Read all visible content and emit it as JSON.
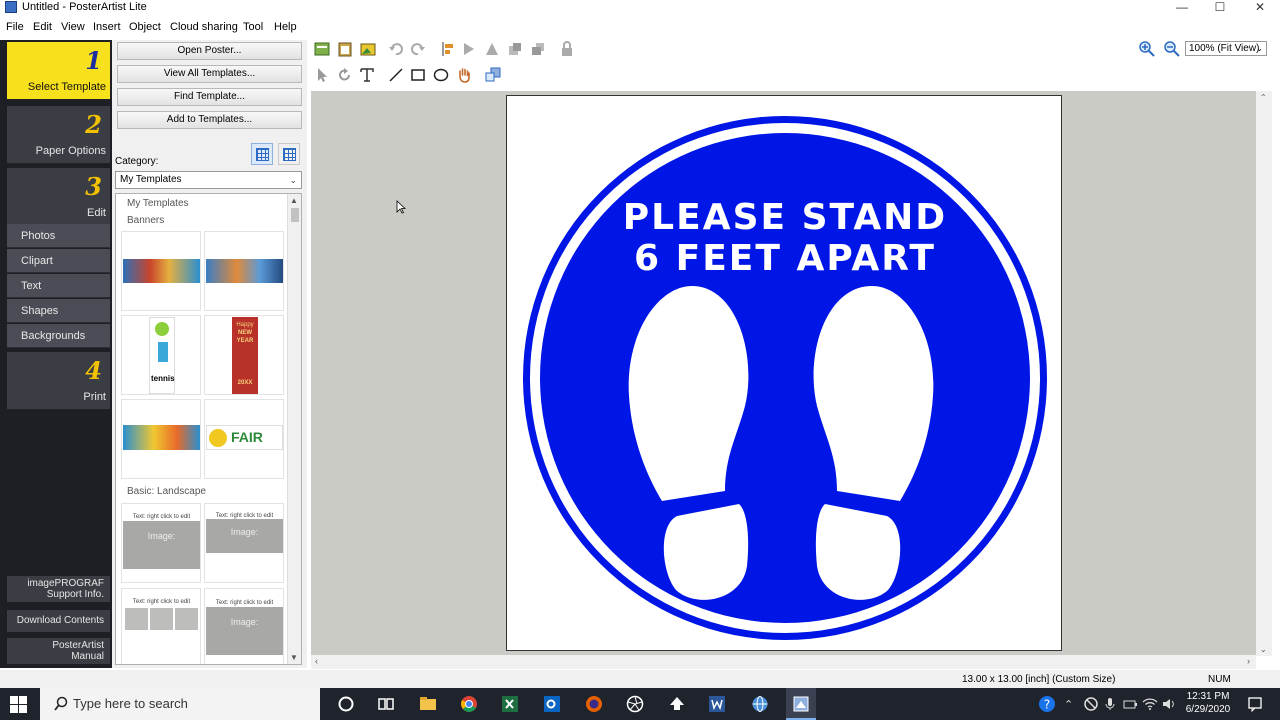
{
  "window": {
    "title": "Untitled - PosterArtist Lite",
    "minimize": "—",
    "maximize": "☐",
    "close": "✕"
  },
  "menu": [
    "File",
    "Edit",
    "View",
    "Insert",
    "Object",
    "Cloud sharing",
    "Tool",
    "Help"
  ],
  "wizard": {
    "steps": [
      {
        "num": "1",
        "label": "Select Template"
      },
      {
        "num": "2",
        "label": "Paper Options"
      },
      {
        "num": "3",
        "label": "Edit"
      },
      {
        "num": "4",
        "label": "Print"
      }
    ],
    "edit_items": [
      "Photos",
      "Clipart",
      "Text",
      "Shapes",
      "Backgrounds"
    ],
    "bottom_links": [
      {
        "line1": "imagePROGRAF",
        "line2": "Support Info."
      },
      {
        "line1": "Download Contents",
        "line2": ""
      },
      {
        "line1": "PosterArtist",
        "line2": "Manual"
      }
    ]
  },
  "templates_panel": {
    "buttons": [
      "Open Poster...",
      "View All Templates...",
      "Find Template...",
      "Add to Templates..."
    ],
    "category_label": "Category:",
    "category_value": "My Templates",
    "groups": [
      "My Templates",
      "Banners",
      "Basic: Landscape"
    ],
    "thumb_texts": {
      "tennis": "tennis",
      "happy": "Happy",
      "newyear": "NEW YEAR",
      "year": "20XX",
      "fair": "FAIR",
      "placeholder_text": "Text: right click to edit",
      "placeholder_image": "Image:"
    }
  },
  "zoom": {
    "value": "100% (Fit View)"
  },
  "poster": {
    "line1": "PLEASE STAND",
    "line2": "6 FEET APART",
    "blue": "#0016e6"
  },
  "status": {
    "size": "13.00 x 13.00 [inch] (Custom Size)",
    "num": "NUM"
  },
  "taskbar": {
    "search_placeholder": "Type here to search",
    "time": "12:31 PM",
    "date": "6/29/2020"
  }
}
